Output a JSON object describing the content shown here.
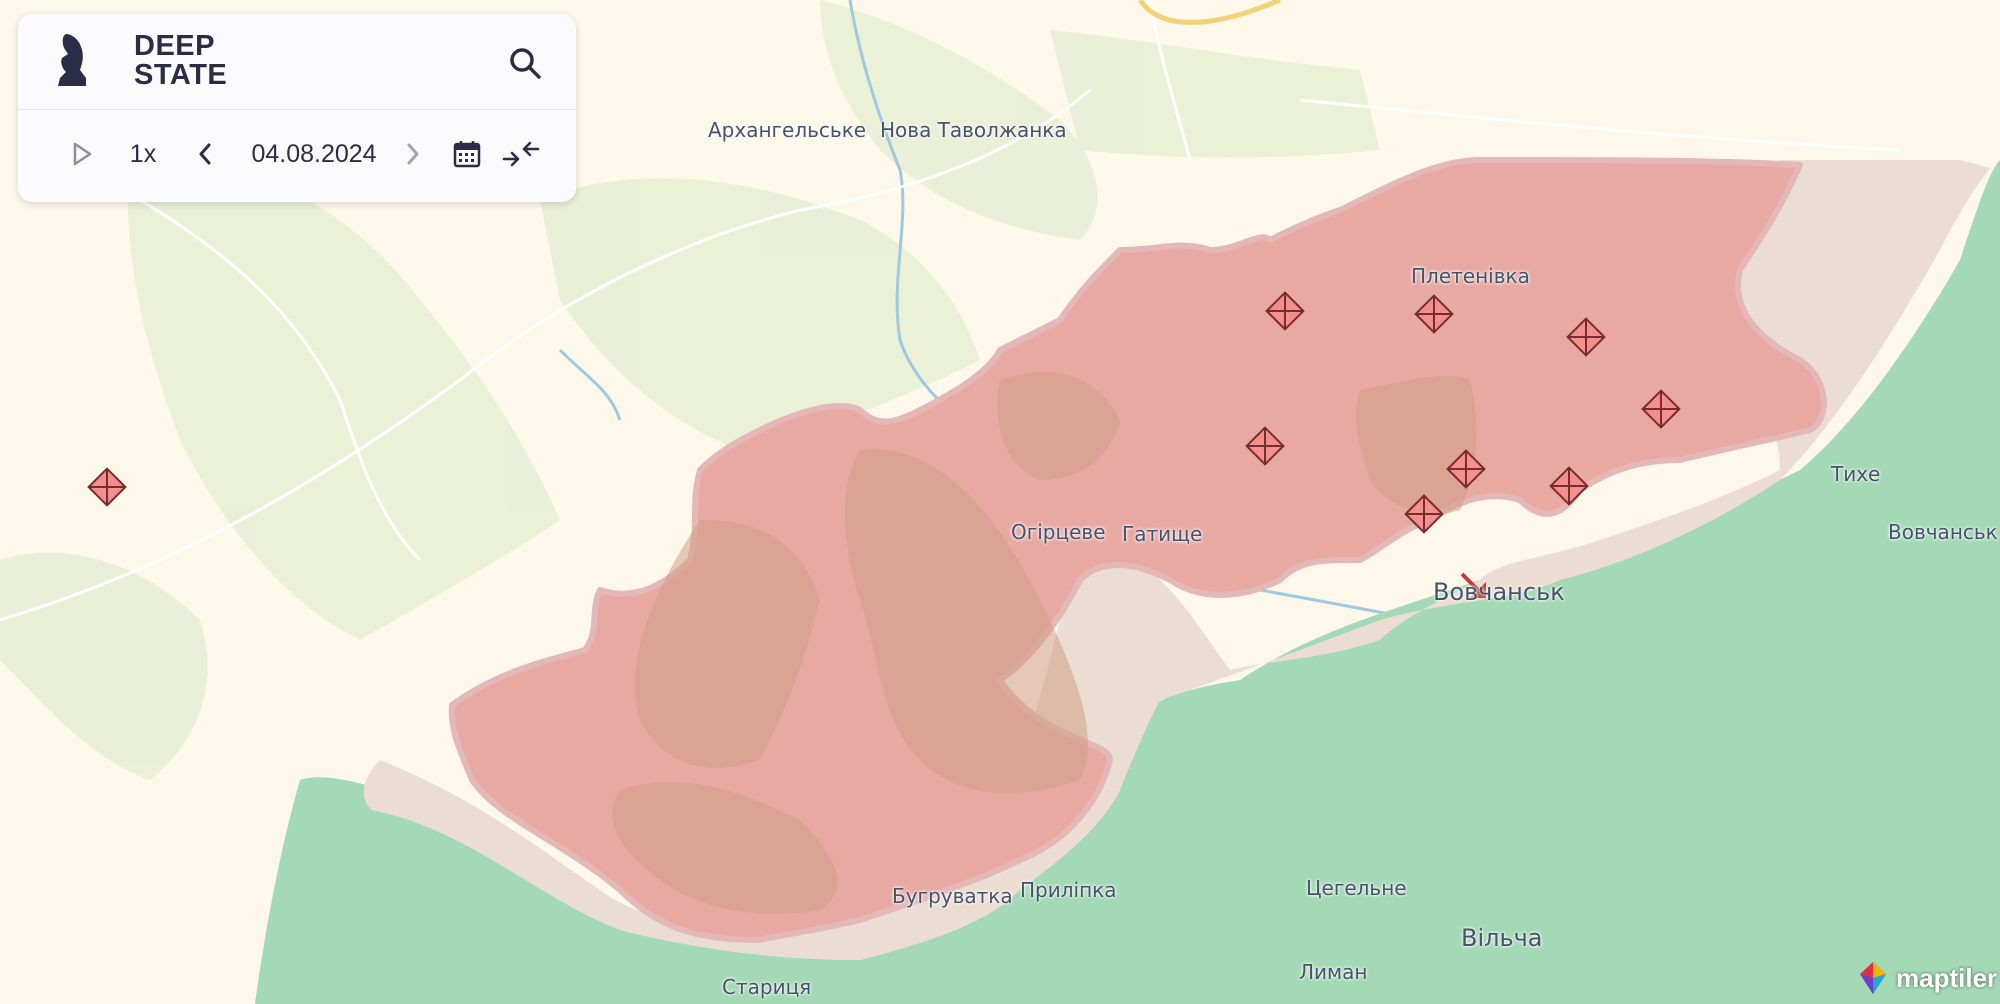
{
  "app": {
    "logo_line1": "DEEP",
    "logo_line2": "STATE",
    "search_icon": "search-icon"
  },
  "timeline": {
    "play_icon": "play-icon",
    "speed": "1x",
    "prev_icon": "chevron-left-icon",
    "date": "04.08.2024",
    "next_icon": "chevron-right-icon",
    "calendar_icon": "calendar-icon",
    "collapse_icon": "collapse-arrows-icon"
  },
  "map": {
    "colors": {
      "background": "#fdf8ea",
      "forest": "#ecf0d8",
      "occupied": "#e8a8a2",
      "contested": "#e9ddd2",
      "liberated": "#9ed8b0",
      "marker": "#f28f8f"
    },
    "places": {
      "arkhanhelske": "Архангельське",
      "nova_tavolzhanka": "Нова Таволжанка",
      "pletenivka": "Плетенівка",
      "ohirtseve": "Огірцеве",
      "hatyshche": "Гатище",
      "vovchansk": "Вовчанськ",
      "tykhe": "Тихе",
      "vovchanski": "Вовчанськ",
      "buhruvatka": "Бугруватка",
      "prylipka": "Приліпка",
      "tsehelne": "Цегельне",
      "vilcha": "Вільча",
      "lyman": "Лиман",
      "starytsia": "Стариця"
    },
    "marker_icon": "airstrike-marker-icon",
    "arrow_icon": "attack-arrow-icon"
  },
  "attribution": {
    "brand": "maptiler",
    "icon": "maptiler-logo-icon"
  }
}
